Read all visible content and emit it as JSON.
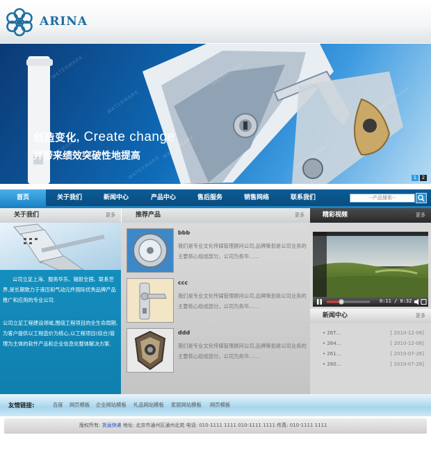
{
  "header": {
    "brand": "ARINA"
  },
  "banner": {
    "line1_zh": "创造变化,",
    "line1_en": "Create change",
    "line2": "并带来绩效突破性地提高",
    "watermark": "WATERMARK",
    "pages": [
      "1",
      "2"
    ]
  },
  "nav": {
    "items": [
      "首页",
      "关于我们",
      "新闻中心",
      "产品中心",
      "售后服务",
      "销售网络",
      "联系我们"
    ],
    "search_placeholder": "--产品搜索--"
  },
  "about": {
    "title": "关于我们",
    "more": "更多",
    "para1": "公司立足上海、服务华东、辐射全国、联系世界,是长期致力于液压和气动元件国际优秀品牌产品推广和应用的专业公司.",
    "para2": "公司立足工程建设领域,围绕工程项目的全生命周期,为客户提供以工程造价为核心,以工程项目(综合)管理为主体的软件产品和企业信息化整体解决方案."
  },
  "products": {
    "title": "推荐产品",
    "more": "更多",
    "items": [
      {
        "name": "bbb",
        "desc": "我们是专业文化传媒管理顾问公司,品牌策划是公司业务的主要核心组成部分。公司为务华……"
      },
      {
        "name": "ccc",
        "desc": "我们是专业文化传媒管理顾问公司,品牌策划是公司业务的主要核心组成部分。公司为务华……"
      },
      {
        "name": "ddd",
        "desc": "我们是专业文化传媒管理顾问公司,品牌策划是公司业务的主要核心组成部分。公司为务华……"
      }
    ]
  },
  "video": {
    "title": "精彩视频",
    "more": "更多",
    "time": "0:11 / 0:32",
    "progress": 0.34
  },
  "news": {
    "title": "新闻中心",
    "more": "更多",
    "items": [
      {
        "title": "• 26T…",
        "date": "[ 2010-12-08]"
      },
      {
        "title": "• 264…",
        "date": "[ 2010-12-08]"
      },
      {
        "title": "• 261…",
        "date": "[ 2010-07-26]"
      },
      {
        "title": "• 260…",
        "date": "[ 2010-07-26]"
      }
    ]
  },
  "friend_links": {
    "label": "友情链接:",
    "items": [
      "百度",
      "网页模板",
      "企业网站模板",
      "礼品网站模板",
      "家居网站模板",
      "网页模板"
    ]
  },
  "footer": {
    "prefix": "版权所有:",
    "company": "货运快递",
    "address": "地址: 北京市通州区通州北苑  电话: 010-1111 1111   010-1111 1111   传真: 010-1111 1111"
  }
}
